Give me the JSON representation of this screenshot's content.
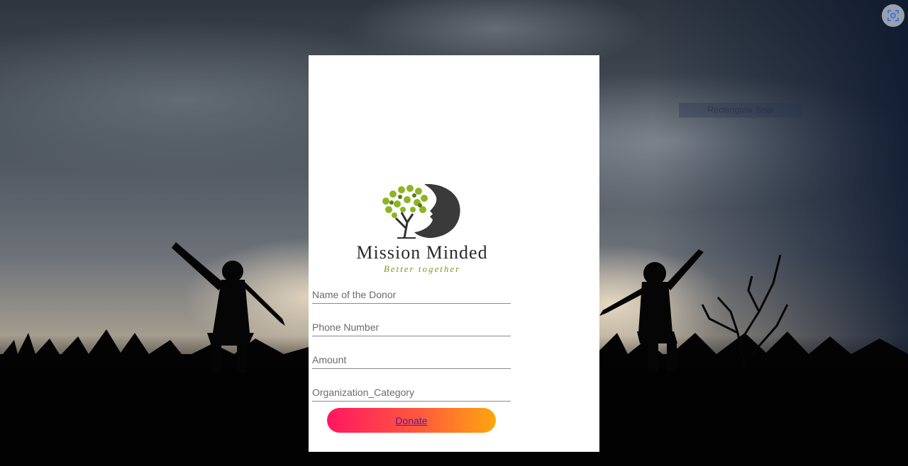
{
  "background": {
    "overlay_label": "Rectangular Snip"
  },
  "logo": {
    "title": "Mission Minded",
    "subtitle": "Better together"
  },
  "form": {
    "donor_name_placeholder": "Name of the Donor",
    "phone_placeholder": "Phone Number",
    "amount_placeholder": "Amount",
    "category_placeholder": "Organization_Category",
    "submit_label": "Donate"
  },
  "colors": {
    "button_gradient_start": "#ff1661",
    "button_gradient_end": "#ffa60d",
    "logo_accent": "#7c9a1a"
  },
  "icons": {
    "screen_capture": "screen-capture-icon"
  }
}
